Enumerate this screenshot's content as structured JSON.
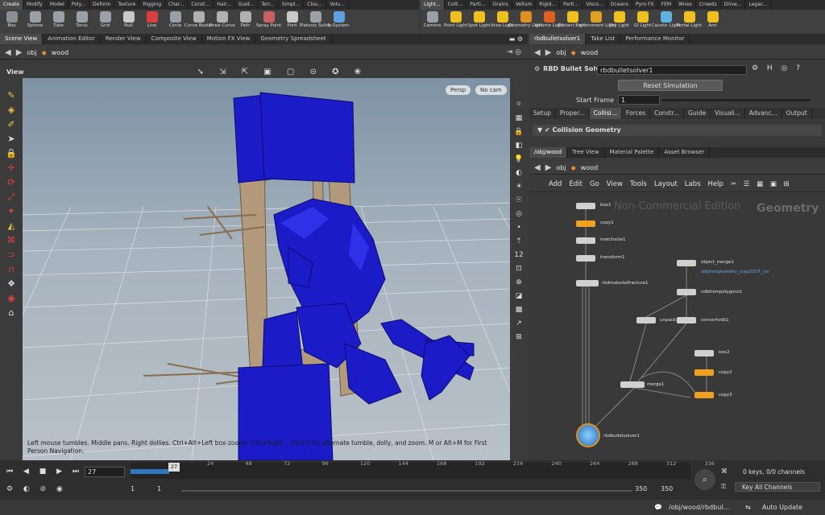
{
  "shelf_tabs_left": [
    "Create",
    "Modify",
    "Model",
    "Poly...",
    "Deform",
    "Texture",
    "Rigging",
    "Char...",
    "Const...",
    "Hair...",
    "Guid...",
    "Terr...",
    "Simpl...",
    "Clou...",
    "Volu..."
  ],
  "shelf_tabs_right": [
    "Light...",
    "Colli...",
    "Parti...",
    "Grains",
    "Vellum",
    "Rigid...",
    "Parti...",
    "Visco...",
    "Oceans",
    "Pyro FX",
    "FEM",
    "Wires",
    "Crowds",
    "Drive...",
    "Legac..."
  ],
  "shelf_tools_left": [
    {
      "label": "Box",
      "icon": "box-icon",
      "color": "#8a8f96"
    },
    {
      "label": "Sphere",
      "icon": "sphere-icon",
      "color": "#9aa0a8"
    },
    {
      "label": "Tube",
      "icon": "tube-icon",
      "color": "#9aa0a8"
    },
    {
      "label": "Torus",
      "icon": "torus-icon",
      "color": "#9aa0a8"
    },
    {
      "label": "Grid",
      "icon": "grid-icon",
      "color": "#9aa0a8"
    },
    {
      "label": "Null",
      "icon": "null-icon",
      "color": "#c8c8c8"
    },
    {
      "label": "Line",
      "icon": "line-icon",
      "color": "#d84040"
    },
    {
      "label": "Circle",
      "icon": "circle-icon",
      "color": "#9aa0a8"
    },
    {
      "label": "Curve Bezier",
      "icon": "curve-bezier-icon",
      "color": "#b0b0b0"
    },
    {
      "label": "Draw Curve",
      "icon": "draw-curve-icon",
      "color": "#b0b0b0"
    },
    {
      "label": "Path",
      "icon": "path-icon",
      "color": "#b0b0b0"
    },
    {
      "label": "Spray Paint",
      "icon": "spray-paint-icon",
      "color": "#c86060"
    },
    {
      "label": "Font",
      "icon": "font-icon",
      "color": "#c8c8c8"
    },
    {
      "label": "Platonic Solids",
      "icon": "platonic-solids-icon",
      "color": "#9aa0a8"
    },
    {
      "label": "L-System",
      "icon": "l-system-icon",
      "color": "#5fa0e0"
    }
  ],
  "shelf_tools_right": [
    {
      "label": "Camera",
      "icon": "camera-icon",
      "color": "#9aa0a8"
    },
    {
      "label": "Point Light",
      "icon": "point-light-icon",
      "color": "#f0c020"
    },
    {
      "label": "Spot Light",
      "icon": "spot-light-icon",
      "color": "#f0c020"
    },
    {
      "label": "Area Light",
      "icon": "area-light-icon",
      "color": "#f0c020"
    },
    {
      "label": "Geometry Light",
      "icon": "geometry-light-icon",
      "color": "#e09020"
    },
    {
      "label": "Volume Light",
      "icon": "volume-light-icon",
      "color": "#e06020"
    },
    {
      "label": "Distant Light",
      "icon": "distant-light-icon",
      "color": "#f0c020"
    },
    {
      "label": "Environment Light",
      "icon": "environment-light-icon",
      "color": "#e0a020"
    },
    {
      "label": "Sky Light",
      "icon": "sky-light-icon",
      "color": "#f0c020"
    },
    {
      "label": "GI Light",
      "icon": "gi-light-icon",
      "color": "#f0c020"
    },
    {
      "label": "Caustic Light",
      "icon": "caustic-light-icon",
      "color": "#60b0e0"
    },
    {
      "label": "Portal Light",
      "icon": "portal-light-icon",
      "color": "#f0c020"
    },
    {
      "label": "Ami",
      "icon": "ambient-light-icon",
      "color": "#f0c020"
    }
  ],
  "left_panes": {
    "tabs": [
      "Scene View",
      "Animation Editor",
      "Render View",
      "Composite View",
      "Motion FX View",
      "Geometry Spreadsheet"
    ],
    "path": {
      "obj": "obj",
      "node": "wood"
    },
    "view_label": "View",
    "persp": "Persp",
    "camera": "No cam",
    "hint": "Left mouse tumbles. Middle pans. Right dollies. Ctrl+Alt+Left box-zooms. Ctrl+Right... Hold L for alternate tumble, dolly, and zoom.   M or Alt+M for First Person Navigation."
  },
  "param_panes": {
    "tabs": [
      "rbdbulletsolver1",
      "Take List",
      "Performance Monitor"
    ],
    "path": {
      "obj": "obj",
      "node": "wood"
    },
    "node_type": "RBD Bullet Solver",
    "node_name": "rbdbulletsolver1",
    "reset_label": "Reset Simulation",
    "start_frame_label": "Start Frame",
    "start_frame_value": "1",
    "param_tabs": [
      "Setup",
      "Proper...",
      "Collisi...",
      "Forces",
      "Constr...",
      "Guide",
      "Visuali...",
      "Advanc...",
      "Output"
    ],
    "section": "Collision Geometry"
  },
  "network_panes": {
    "tabs": [
      "/obj/wood",
      "Tree View",
      "Material Palette",
      "Asset Browser"
    ],
    "path": {
      "obj": "obj",
      "node": "wood"
    },
    "menus": [
      "Add",
      "Edit",
      "Go",
      "View",
      "Tools",
      "Layout",
      "Labs",
      "Help"
    ],
    "watermark": "Non-Commercial Edition",
    "context": "Geometry",
    "nodes": [
      {
        "name": "box1",
        "color": "#cfcfcf"
      },
      {
        "name": "copy1",
        "color": "#f0a020"
      },
      {
        "name": "matchsize1",
        "color": "#cfcfcf"
      },
      {
        "name": "transform1",
        "color": "#cfcfcf"
      },
      {
        "name": "rbdmaterialfracture1",
        "color": "#cfcfcf"
      },
      {
        "name": "object_merge1",
        "color": "#cfcfcf"
      },
      {
        "name": "vdbfrompolygons1",
        "color": "#cfcfcf"
      },
      {
        "name": "unpack1",
        "color": "#cfcfcf"
      },
      {
        "name": "convertvdb1",
        "color": "#cfcfcf"
      },
      {
        "name": "box2",
        "color": "#cfcfcf"
      },
      {
        "name": "copy2",
        "color": "#f0a020"
      },
      {
        "name": "merge1",
        "color": "#cfcfcf"
      },
      {
        "name": "copy3",
        "color": "#f0a020"
      },
      {
        "name": "rbdbulletsolver1",
        "color": "#cfcfcf"
      }
    ],
    "object_merge_path": "/obj/testgeometry_crag1/OUT_cra"
  },
  "timeline": {
    "current_frame": "27",
    "ticks": [
      "24",
      "48",
      "72",
      "96",
      "120",
      "144",
      "168",
      "192",
      "216",
      "240",
      "264",
      "288",
      "312",
      "336"
    ],
    "range_start": "1",
    "range_start2": "1",
    "range_end": "350",
    "range_end2": "350",
    "keys_label": "0 keys, 0/0 channels",
    "key_channels": "Key All Channels",
    "status_path": "/obj/wood/rbdbul...",
    "auto_update": "Auto Update"
  }
}
